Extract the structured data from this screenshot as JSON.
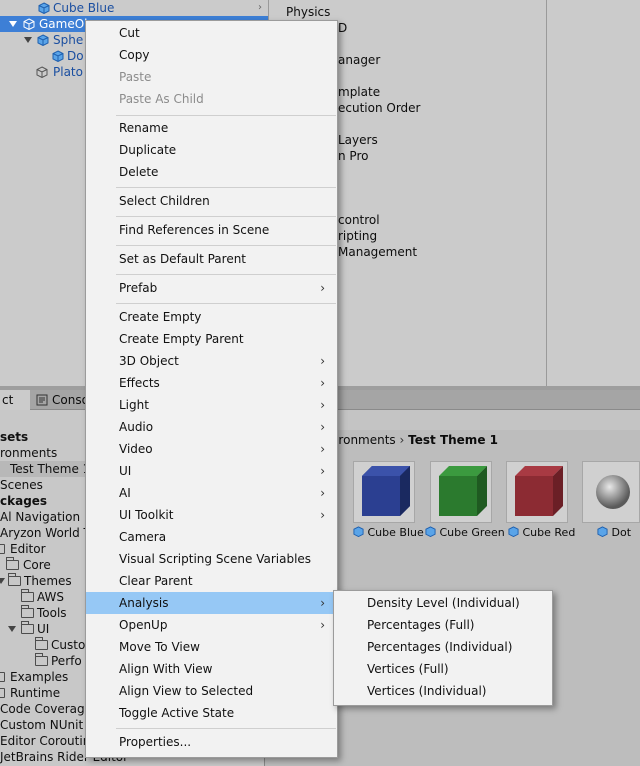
{
  "hierarchy": {
    "items": [
      {
        "label": "Cube Blue"
      },
      {
        "label": "GameOb"
      },
      {
        "label": "Sphe"
      },
      {
        "label": "Do"
      },
      {
        "label": "Plato"
      }
    ]
  },
  "settings_list": {
    "items": [
      "Physics",
      "D",
      "anager",
      "mplate",
      "ecution Order",
      "Layers",
      "n Pro",
      "control",
      "ripting",
      "Management"
    ]
  },
  "bottom_tabs": {
    "project_partial": "ct",
    "console": "Conso"
  },
  "project_tree": {
    "items": [
      "sets",
      "ronments",
      "Test Theme 1",
      "Scenes",
      "ckages",
      "Al Navigation",
      "Aryzon World Th",
      "Editor",
      "Core",
      "Themes",
      "AWS",
      "Tools",
      "UI",
      "Custo",
      "Perfo",
      "Examples",
      "Runtime",
      "Code Coverage",
      "Custom NUnit",
      "Editor Coroutine",
      "JetBrains Rider Editor"
    ]
  },
  "assets_panel": {
    "breadcrumb_parent": "vironments",
    "breadcrumb_sep": "›",
    "breadcrumb_current": "Test Theme 1",
    "thumbs": [
      {
        "label": "Cube Blue",
        "color": "#2b3f91"
      },
      {
        "label": "Cube Green",
        "color": "#2b7a2e"
      },
      {
        "label": "Cube Red",
        "color": "#8c2b33"
      },
      {
        "label": "Dot",
        "color": "#9a9a9a"
      }
    ]
  },
  "context_menu": {
    "items": [
      {
        "label": "Cut"
      },
      {
        "label": "Copy"
      },
      {
        "label": "Paste",
        "disabled": true
      },
      {
        "label": "Paste As Child",
        "disabled": true
      },
      {
        "label": "Rename"
      },
      {
        "label": "Duplicate"
      },
      {
        "label": "Delete"
      },
      {
        "label": "Select Children"
      },
      {
        "label": "Find References in Scene"
      },
      {
        "label": "Set as Default Parent"
      },
      {
        "label": "Prefab",
        "submenu": true
      },
      {
        "label": "Create Empty"
      },
      {
        "label": "Create Empty Parent"
      },
      {
        "label": "3D Object",
        "submenu": true
      },
      {
        "label": "Effects",
        "submenu": true
      },
      {
        "label": "Light",
        "submenu": true
      },
      {
        "label": "Audio",
        "submenu": true
      },
      {
        "label": "Video",
        "submenu": true
      },
      {
        "label": "UI",
        "submenu": true
      },
      {
        "label": "AI",
        "submenu": true
      },
      {
        "label": "UI Toolkit",
        "submenu": true
      },
      {
        "label": "Camera"
      },
      {
        "label": "Visual Scripting Scene Variables"
      },
      {
        "label": "Clear Parent"
      },
      {
        "label": "Analysis",
        "submenu": true,
        "active": true
      },
      {
        "label": "OpenUp",
        "submenu": true
      },
      {
        "label": "Move To View"
      },
      {
        "label": "Align With View"
      },
      {
        "label": "Align View to Selected"
      },
      {
        "label": "Toggle Active State"
      },
      {
        "label": "Properties..."
      }
    ],
    "submenu_glyph": "›"
  },
  "analysis_submenu": {
    "items": [
      {
        "label": "Density Level (Individual)"
      },
      {
        "label": "Percentages (Full)"
      },
      {
        "label": "Percentages (Individual)"
      },
      {
        "label": "Vertices (Full)"
      },
      {
        "label": "Vertices (Individual)"
      }
    ]
  },
  "colors": {
    "selection_blue": "#3d7fd6",
    "menu_highlight": "#96c8f5",
    "menu_bg": "#f2f2f2"
  }
}
